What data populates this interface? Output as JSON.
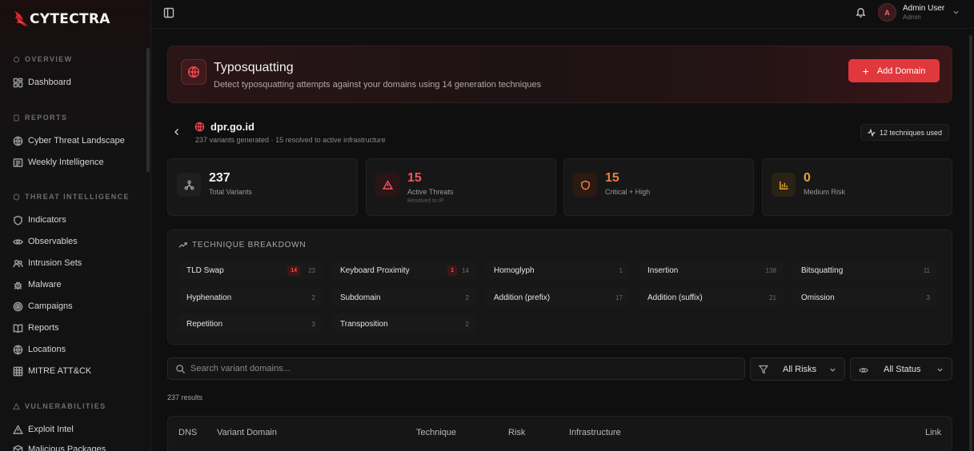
{
  "brand": {
    "name": "CYTECTRA",
    "logo_icon": "wing-logo",
    "accent": "#e0383c"
  },
  "sidebar": {
    "sections": [
      {
        "title": "OVERVIEW",
        "items": [
          {
            "label": "Dashboard",
            "icon": "dashboard-icon"
          }
        ]
      },
      {
        "title": "REPORTS",
        "items": [
          {
            "label": "Cyber Threat Landscape",
            "icon": "globe-icon"
          },
          {
            "label": "Weekly Intelligence",
            "icon": "newspaper-icon"
          }
        ]
      },
      {
        "title": "THREAT INTELLIGENCE",
        "items": [
          {
            "label": "Indicators",
            "icon": "shield-icon"
          },
          {
            "label": "Observables",
            "icon": "eye-icon"
          },
          {
            "label": "Intrusion Sets",
            "icon": "users-icon"
          },
          {
            "label": "Malware",
            "icon": "bug-icon"
          },
          {
            "label": "Campaigns",
            "icon": "target-icon"
          },
          {
            "label": "Reports",
            "icon": "book-icon"
          },
          {
            "label": "Locations",
            "icon": "globe-icon"
          },
          {
            "label": "MITRE ATT&CK",
            "icon": "grid-icon"
          }
        ]
      },
      {
        "title": "VULNERABILITIES",
        "items": [
          {
            "label": "Exploit Intel",
            "icon": "alert-icon"
          },
          {
            "label": "Malicious Packages",
            "icon": "package-icon"
          }
        ]
      }
    ]
  },
  "topbar": {
    "user_name": "Admin User",
    "user_role": "Admin",
    "avatar_initial": "A"
  },
  "hero": {
    "title": "Typosquatting",
    "subtitle": "Detect typosquatting attempts against your domains using 14 generation techniques",
    "add_button": "Add Domain"
  },
  "domain": {
    "name": "dpr.go.id",
    "summary": "237 variants generated · 15 resolved to active infrastructure",
    "techniques_used": "12 techniques used"
  },
  "stats": [
    {
      "value": "237",
      "label": "Total Variants",
      "sub": "",
      "color": "#f0f0f0",
      "icon": "network-icon"
    },
    {
      "value": "15",
      "label": "Active Threats",
      "sub": "Resolved to IP",
      "color": "#f0555a",
      "icon": "alert-icon"
    },
    {
      "value": "15",
      "label": "Critical + High",
      "sub": "",
      "color": "#f07a3a",
      "icon": "shield-icon"
    },
    {
      "value": "0",
      "label": "Medium Risk",
      "sub": "",
      "color": "#e6a23a",
      "icon": "bar-chart-icon"
    }
  ],
  "breakdown": {
    "title": "TECHNIQUE BREAKDOWN",
    "techniques": [
      {
        "name": "TLD Swap",
        "hits": "14",
        "count": "23"
      },
      {
        "name": "Keyboard Proximity",
        "hits": "1",
        "count": "14"
      },
      {
        "name": "Homoglyph",
        "hits": "",
        "count": "1"
      },
      {
        "name": "Insertion",
        "hits": "",
        "count": "138"
      },
      {
        "name": "Bitsquatting",
        "hits": "",
        "count": "11"
      },
      {
        "name": "Hyphenation",
        "hits": "",
        "count": "2"
      },
      {
        "name": "Subdomain",
        "hits": "",
        "count": "2"
      },
      {
        "name": "Addition (prefix)",
        "hits": "",
        "count": "17"
      },
      {
        "name": "Addition (suffix)",
        "hits": "",
        "count": "21"
      },
      {
        "name": "Omission",
        "hits": "",
        "count": "3"
      },
      {
        "name": "Repetition",
        "hits": "",
        "count": "3"
      },
      {
        "name": "Transposition",
        "hits": "",
        "count": "2"
      }
    ]
  },
  "filters": {
    "search_placeholder": "Search variant domains...",
    "risk_selected": "All Risks",
    "status_selected": "All Status"
  },
  "results_text": "237 results",
  "table": {
    "columns": [
      "DNS",
      "Variant Domain",
      "Technique",
      "Risk",
      "Infrastructure",
      "Link"
    ]
  }
}
